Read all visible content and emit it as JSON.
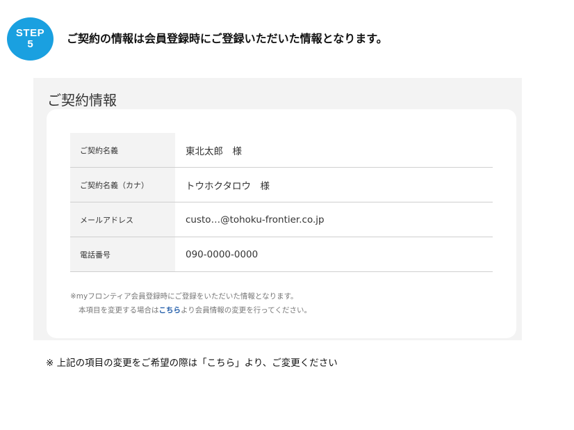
{
  "step": {
    "word": "STEP",
    "number": "5"
  },
  "headline": "ご契約の情報は会員登録時にご登録いただいた情報となります。",
  "panel": {
    "title": "ご契約情報",
    "rows": [
      {
        "label": "ご契約名義",
        "value": "東北太郎　様"
      },
      {
        "label": "ご契約名義（カナ）",
        "value": "トウホクタロウ　様"
      },
      {
        "label": "メールアドレス",
        "value": "custo…@tohoku-frontier.co.jp"
      },
      {
        "label": "電話番号",
        "value": "090-0000-0000"
      }
    ],
    "note_line1": "※myフロンティア会員登録時にご登録をいただいた情報となります。",
    "note_line2_before": "本項目を変更する場合は",
    "note_link": "こちら",
    "note_line2_after": "より会員情報の変更を行ってください。"
  },
  "footer_note": "※ 上記の項目の変更をご希望の際は「こちら」より、ご変更ください",
  "colors": {
    "badge": "#1aa0e0",
    "link": "#1f5ba8",
    "panel_bg": "#f3f3f3"
  }
}
